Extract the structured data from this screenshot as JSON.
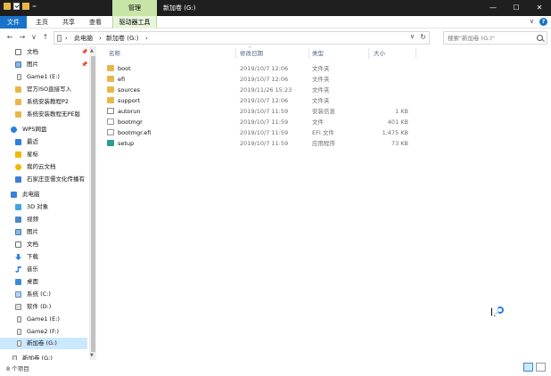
{
  "titlebar": {
    "context_tab": "管理",
    "title": "新加卷 (G:)",
    "minimize": "—",
    "maximize": "☐",
    "close": "✕",
    "qa_sep": "="
  },
  "ribbon": {
    "tabs": [
      "文件",
      "主页",
      "共享",
      "查看"
    ],
    "context_tab": "驱动器工具",
    "collapse": "∨",
    "help": "?"
  },
  "address": {
    "back": "←",
    "forward": "→",
    "dropdown": "∨",
    "up": "↑",
    "crumbs": [
      "此电脑",
      "新加卷 (G:)"
    ],
    "sep": "›",
    "history": "∨",
    "refresh": "↻",
    "search_placeholder": "搜索\"新加卷 (G:)\""
  },
  "nav": {
    "items": [
      {
        "label": "文档",
        "pinned": true
      },
      {
        "label": "图片",
        "pinned": true
      },
      {
        "label": "Game1 (E:)",
        "pinned": false
      },
      {
        "label": "官方ISO直接写入",
        "pinned": false
      },
      {
        "label": "系统安装教程P2",
        "pinned": false
      },
      {
        "label": "系统安装教程无PE版",
        "pinned": false
      },
      {
        "label": "WPS网盘",
        "pinned": false
      },
      {
        "label": "最近",
        "pinned": false
      },
      {
        "label": "星标",
        "pinned": false
      },
      {
        "label": "我的云文档",
        "pinned": false
      },
      {
        "label": "石家庄亚儒文化传播有",
        "pinned": false
      },
      {
        "label": "此电脑",
        "pinned": false
      },
      {
        "label": "3D 对象",
        "pinned": false
      },
      {
        "label": "视频",
        "pinned": false
      },
      {
        "label": "图片",
        "pinned": false
      },
      {
        "label": "文档",
        "pinned": false
      },
      {
        "label": "下载",
        "pinned": false
      },
      {
        "label": "音乐",
        "pinned": false
      },
      {
        "label": "桌面",
        "pinned": false
      },
      {
        "label": "系统 (C:)",
        "pinned": false
      },
      {
        "label": "软件 (D:)",
        "pinned": false
      },
      {
        "label": "Game1 (E:)",
        "pinned": false
      },
      {
        "label": "Game2 (F:)",
        "pinned": false
      },
      {
        "label": "新加卷 (G:)",
        "pinned": false
      },
      {
        "label": "新加卷 (G:)",
        "pinned": false
      }
    ],
    "pin_glyph": "📌"
  },
  "columns": {
    "name": "名称",
    "date": "修改日期",
    "type": "类型",
    "size": "大小",
    "sort_glyph": "^"
  },
  "files": [
    {
      "name": "boot",
      "date": "2019/10/7 12:06",
      "type": "文件夹",
      "size": "",
      "icon": "folder"
    },
    {
      "name": "efi",
      "date": "2019/10/7 12:06",
      "type": "文件夹",
      "size": "",
      "icon": "folder"
    },
    {
      "name": "sources",
      "date": "2019/11/26 15:23",
      "type": "文件夹",
      "size": "",
      "icon": "folder"
    },
    {
      "name": "support",
      "date": "2019/10/7 12:06",
      "type": "文件夹",
      "size": "",
      "icon": "folder"
    },
    {
      "name": "autorun",
      "date": "2019/10/7 11:59",
      "type": "安装信息",
      "size": "1 KB",
      "icon": "ini"
    },
    {
      "name": "bootmgr",
      "date": "2019/10/7 11:59",
      "type": "文件",
      "size": "401 KB",
      "icon": "file"
    },
    {
      "name": "bootmgr.efi",
      "date": "2019/10/7 11:59",
      "type": "EFI 文件",
      "size": "1,475 KB",
      "icon": "efi"
    },
    {
      "name": "setup",
      "date": "2019/10/7 11:59",
      "type": "应用程序",
      "size": "73 KB",
      "icon": "setup"
    }
  ],
  "scroll": {
    "up": "▲",
    "down": "▼"
  },
  "status": {
    "item_count": "8 个项目"
  }
}
